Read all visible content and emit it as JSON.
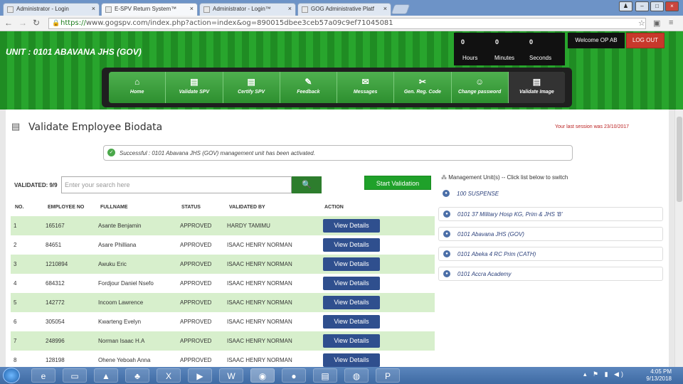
{
  "browser": {
    "tabs": [
      {
        "label": "Administrator - Login"
      },
      {
        "label": "E-SPV Return System™"
      },
      {
        "label": "Administrator - Login™"
      },
      {
        "label": "GOG Administrative Platf"
      }
    ],
    "url_scheme": "https://",
    "url_rest": "www.gogspv.com/index.php?action=index&og=890015dbee3ceb57a09c9ef71045081"
  },
  "header": {
    "unit_title": "UNIT : 0101 ABAVANA JHS (GOV)",
    "timer": {
      "hours": "0",
      "minutes": "0",
      "seconds": "0",
      "hours_label": "Hours",
      "minutes_label": "Minutes",
      "seconds_label": "Seconds"
    },
    "welcome": "Welcome OP AB",
    "logout_label": "LOG OUT"
  },
  "nav": {
    "items": [
      {
        "label": "Home",
        "icon": "home-icon"
      },
      {
        "label": "Validate SPV",
        "icon": "document-icon"
      },
      {
        "label": "Certify SPV",
        "icon": "document-icon"
      },
      {
        "label": "Feedback",
        "icon": "notepad-icon"
      },
      {
        "label": "Messages",
        "icon": "envelope-icon"
      },
      {
        "label": "Gen. Reg. Code",
        "icon": "scroll-icon"
      },
      {
        "label": "Change password",
        "icon": "users-icon"
      },
      {
        "label": "Validate Image",
        "icon": "document-icon"
      }
    ]
  },
  "page": {
    "title": "Validate Employee Biodata",
    "last_session": "Your last session was 23/10/2017",
    "alert": "Successful : 0101 Abavana JHS (GOV) management unit has been activated.",
    "validated_count": "VALIDATED: 9/9",
    "search_placeholder": "Enter your search here",
    "start_validation_label": "Start Validation"
  },
  "table": {
    "headers": [
      "NO.",
      "EMPLOYEE NO",
      "FULLNAME",
      "STATUS",
      "VALIDATED BY",
      "ACTION"
    ],
    "rows": [
      {
        "no": "1",
        "emp": "165167",
        "name": "Asante Benjamin",
        "status": "APPROVED",
        "by": "HARDY TAMIMU",
        "action": "View Details"
      },
      {
        "no": "2",
        "emp": "84651",
        "name": "Asare Philliana",
        "status": "APPROVED",
        "by": "ISAAC HENRY NORMAN",
        "action": "View Details"
      },
      {
        "no": "3",
        "emp": "1210894",
        "name": "Awuku Eric",
        "status": "APPROVED",
        "by": "ISAAC HENRY NORMAN",
        "action": "View Details"
      },
      {
        "no": "4",
        "emp": "684312",
        "name": "Fordjour Daniel Nsefo",
        "status": "APPROVED",
        "by": "ISAAC HENRY NORMAN",
        "action": "View Details"
      },
      {
        "no": "5",
        "emp": "142772",
        "name": "Incoom Lawrence",
        "status": "APPROVED",
        "by": "ISAAC HENRY NORMAN",
        "action": "View Details"
      },
      {
        "no": "6",
        "emp": "305054",
        "name": "Kwarteng Evelyn",
        "status": "APPROVED",
        "by": "ISAAC HENRY NORMAN",
        "action": "View Details"
      },
      {
        "no": "7",
        "emp": "248996",
        "name": "Norman Isaac H.A",
        "status": "APPROVED",
        "by": "ISAAC HENRY NORMAN",
        "action": "View Details"
      },
      {
        "no": "8",
        "emp": "128198",
        "name": "Ohene Yeboah Anna",
        "status": "APPROVED",
        "by": "ISAAC HENRY NORMAN",
        "action": "View Details"
      }
    ]
  },
  "sidebar": {
    "heading": "Management Unit(s) -- Click list below to switch",
    "units": [
      "100 SUSPENSE",
      "0101 37 Military Hosp KG, Prim & JHS 'B'",
      "0101 Abavana JHS (GOV)",
      "0101 Abeka 4 RC Prim (CATH)",
      "0101 Accra Academy"
    ]
  },
  "taskbar": {
    "time": "4:05 PM",
    "date": "9/13/2018"
  }
}
